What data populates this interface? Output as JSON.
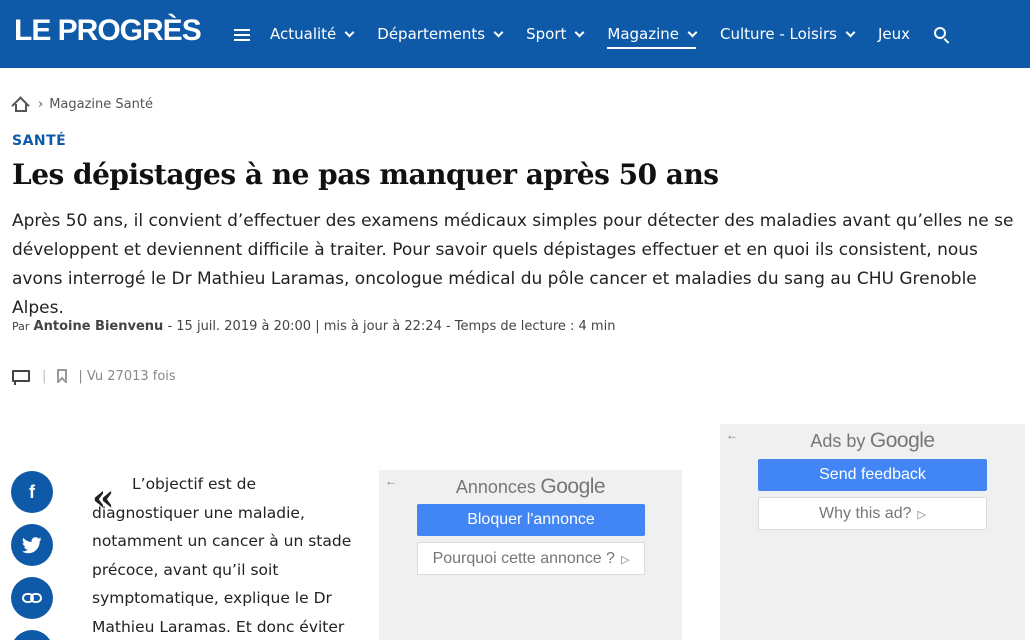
{
  "header": {
    "logo": "LE PROGRÈS",
    "nav": [
      {
        "label": "Actualité",
        "has_dropdown": true,
        "active": false
      },
      {
        "label": "Départements",
        "has_dropdown": true,
        "active": false
      },
      {
        "label": "Sport",
        "has_dropdown": true,
        "active": false
      },
      {
        "label": "Magazine",
        "has_dropdown": true,
        "active": true
      },
      {
        "label": "Culture - Loisirs",
        "has_dropdown": true,
        "active": false
      },
      {
        "label": "Jeux",
        "has_dropdown": false,
        "active": false
      }
    ],
    "bg_color": "#0f5aa8"
  },
  "breadcrumb": {
    "separator": "›",
    "section": "Magazine Santé"
  },
  "article": {
    "kicker": "SANTÉ",
    "title": "Les dépistages à ne pas manquer après 50 ans",
    "lead": "Après 50 ans, il convient d’effectuer des examens médicaux simples pour détecter des maladies avant qu’elles ne se développent et deviennent difficile à traiter. Pour savoir quels dépistages effectuer et en quoi ils consistent, nous avons interrogé le Dr Mathieu Laramas, oncologue médical du pôle cancer et maladies du sang au CHU Grenoble Alpes.",
    "byline": {
      "prefix": "Par",
      "author": "Antoine Bienvenu",
      "meta": "- 15 juil. 2019 à 20:00 | mis à jour à 22:24 - Temps de lecture : 4 min"
    },
    "views": "| Vu 27013 fois",
    "quote_mark": "«",
    "quote_text": "L’objectif est de diagnostiquer une maladie, notamment un cancer à un stade précoce, avant qu’il soit symptomatique, explique le Dr Mathieu Laramas. Et donc éviter"
  },
  "social": {
    "facebook": "f",
    "twitter_icon": "twitter-bird-icon",
    "link_icon": "link-icon"
  },
  "ads": {
    "ad1": {
      "back_arrow": "←",
      "heading_prefix": "Annonces",
      "heading_brand": "Google",
      "primary_button": "Bloquer l'annonce",
      "secondary_button": "Pourquoi cette annonce ?"
    },
    "ad2": {
      "back_arrow": "←",
      "heading_prefix": "Ads by",
      "heading_brand": "Google",
      "primary_button": "Send feedback",
      "secondary_button": "Why this ad?"
    },
    "play_glyph": "▷"
  }
}
